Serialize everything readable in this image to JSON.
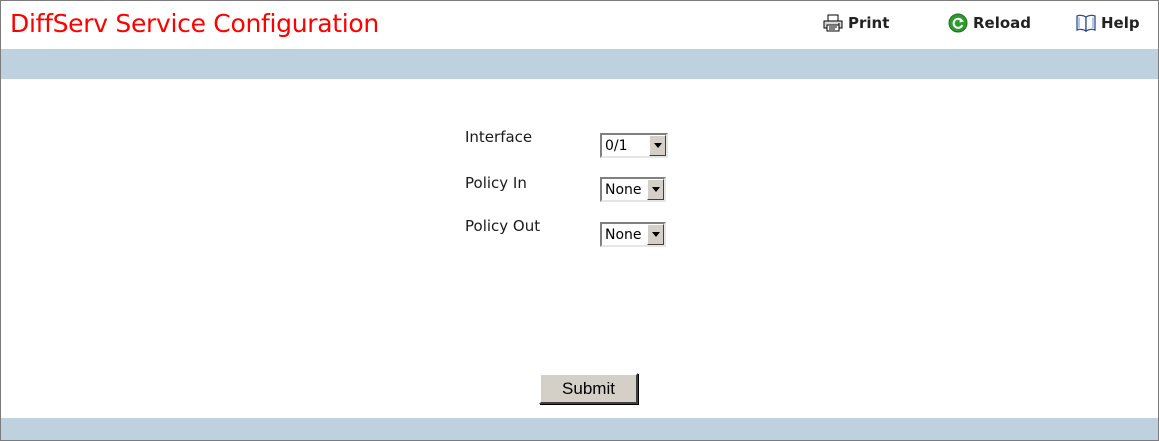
{
  "header": {
    "title": "DiffServ Service Configuration",
    "title_color": "#ff0000",
    "actions": {
      "print_label": "Print",
      "reload_label": "Reload",
      "help_label": "Help"
    },
    "icons": [
      "printer-icon",
      "reload-icon",
      "help-book-icon"
    ]
  },
  "colors": {
    "band": "#bdd1df",
    "reload_icon": "#2e9b2e"
  },
  "form": {
    "interface": {
      "label": "Interface",
      "value": "0/1"
    },
    "policy_in": {
      "label": "Policy In",
      "value": "None"
    },
    "policy_out": {
      "label": "Policy Out",
      "value": "None"
    },
    "submit_label": "Submit"
  }
}
